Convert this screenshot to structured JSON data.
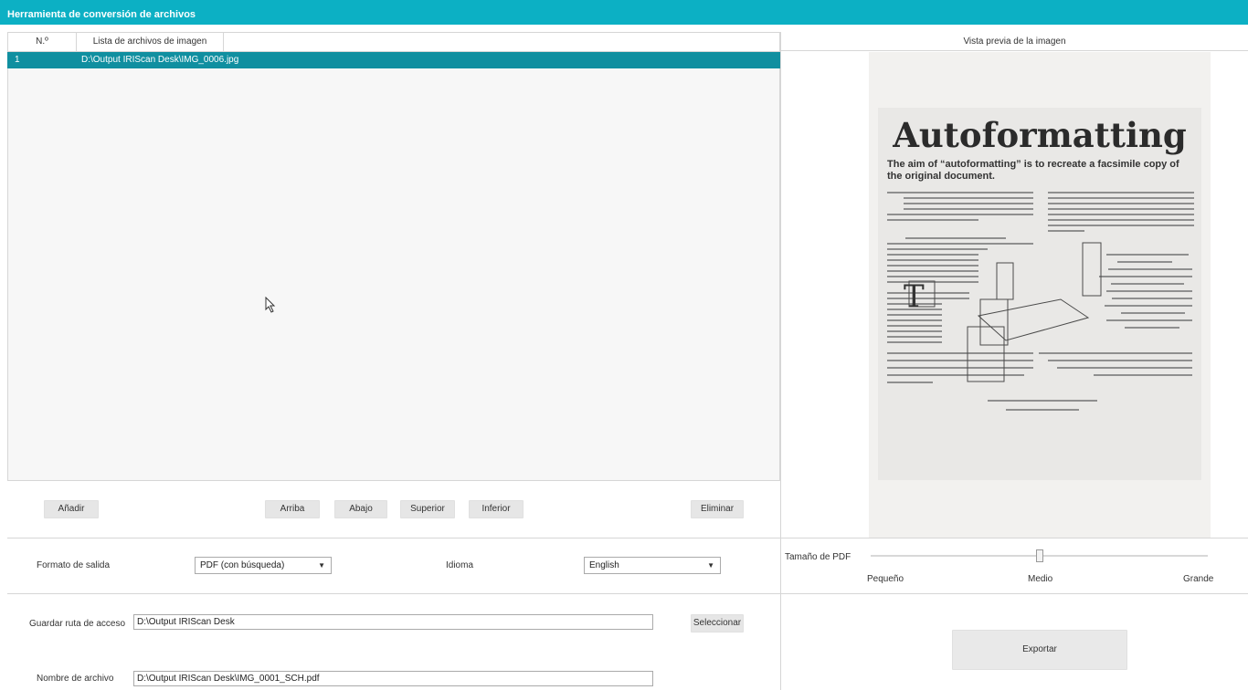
{
  "app": {
    "title": "Herramienta de conversión de archivos"
  },
  "file_list": {
    "col_number": "N.º",
    "col_files": "Lista de archivos de imagen",
    "rows": [
      {
        "number": "1",
        "path": "D:\\Output IRIScan Desk\\IMG_0006.jpg"
      }
    ]
  },
  "buttons": {
    "add": "Añadir",
    "up": "Arriba",
    "down": "Abajo",
    "top": "Superior",
    "bottom": "Inferior",
    "delete": "Eliminar",
    "select": "Seleccionar",
    "export": "Exportar"
  },
  "output": {
    "format_label": "Formato de salida",
    "format_value": "PDF (con búsqueda)",
    "language_label": "Idioma",
    "language_value": "English",
    "save_path_label": "Guardar ruta de acceso",
    "save_path_value": "D:\\Output IRIScan Desk",
    "file_name_label": "Nombre de archivo",
    "file_name_value": "D:\\Output IRIScan Desk\\IMG_0001_SCH.pdf"
  },
  "preview": {
    "title": "Vista previa de la imagen",
    "doc_title": "Autoformatting",
    "doc_subtitle": "The aim of “autoformatting” is to recreate a facsimile copy of the original document."
  },
  "pdf_size": {
    "label": "Tamaño de PDF",
    "small": "Pequeño",
    "medium": "Medio",
    "large": "Grande",
    "level_fraction": 0.5
  },
  "icons": {
    "cursor": "mouse-pointer-icon",
    "dropdown": "chevron-down-icon"
  },
  "colors": {
    "titlebar": "#0cb0c4",
    "selected_row": "#108fa0"
  }
}
